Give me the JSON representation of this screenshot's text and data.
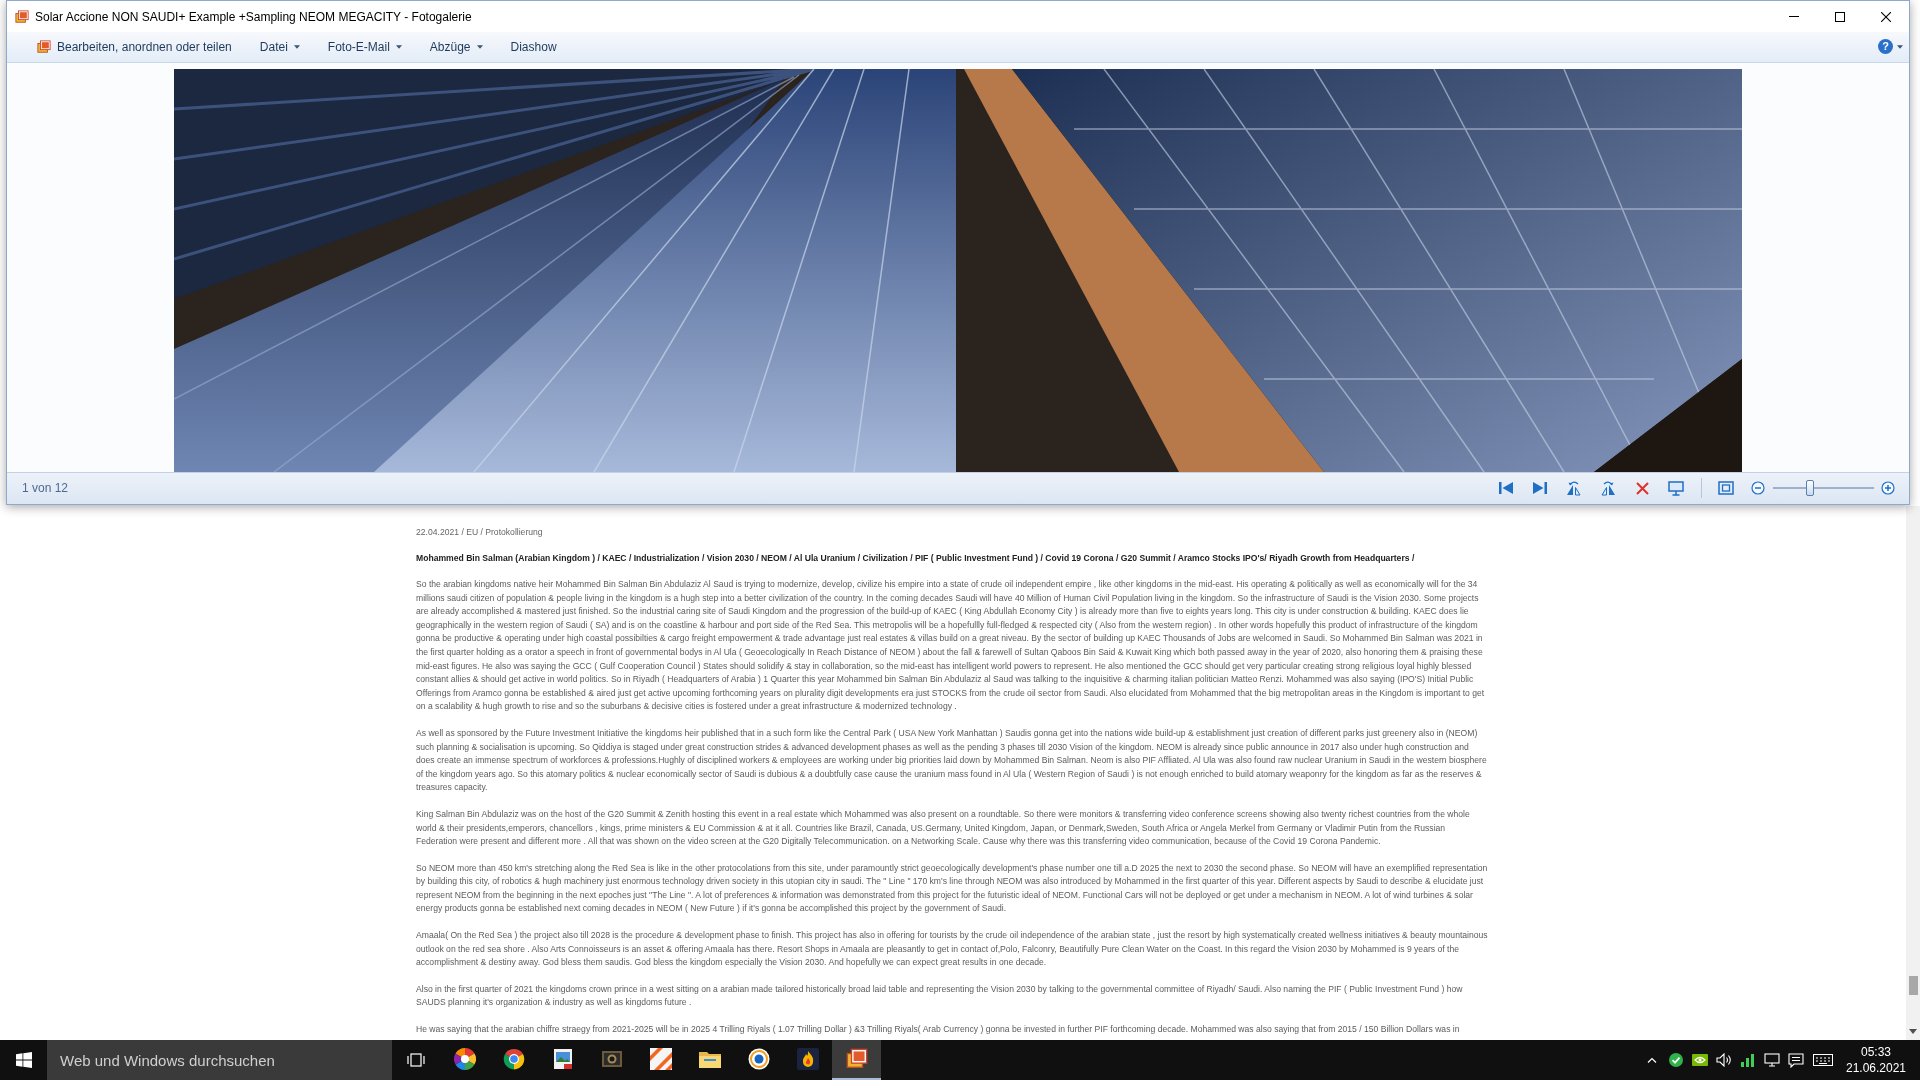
{
  "window": {
    "title": "Solar Accione NON SAUDI+ Example +Sampling NEOM MEGACITY - Fotogalerie"
  },
  "menu": {
    "items": [
      {
        "label": "Bearbeiten, anordnen oder teilen",
        "kind": "icon"
      },
      {
        "label": "Datei",
        "kind": "dropdown"
      },
      {
        "label": "Foto-E-Mail",
        "kind": "dropdown"
      },
      {
        "label": "Abzüge",
        "kind": "dropdown"
      },
      {
        "label": "Diashow",
        "kind": "plain"
      }
    ],
    "help": "?"
  },
  "viewer": {
    "position": "1 von 12",
    "zoom": {
      "level": 0.37
    }
  },
  "document": {
    "meta": "22.04.2021 / EU / Protokollierung",
    "headline": "Mohammed Bin Salman (Arabian Kingdom ) / KAEC / Industrialization / Vision 2030 / NEOM / Al Ula Uranium / Civilization / PIF ( Public Investment Fund ) / Covid 19 Corona / G20 Summit / Aramco Stocks IPO's/ Riyadh Growth from Headquarters /",
    "paragraphs": [
      "So the arabian kingdoms native heir Mohammed Bin Salman Bin Abdulaziz Al Saud is trying to modernize, develop, civilize his empire into a state of crude oil independent empire , like other kingdoms in the mid-east. His operating & politically as well as economically will for the 34 millions saudi citizen of population & people living in the kingdom is a hugh step into a better civilization of the country. In the coming decades Saudi will have 40 Million of Human Civil Population living in the kingdom. So the infrastructure of Saudi is the Vision 2030. Some projects are already accomplished & mastered just finished. So the industrial caring site of Saudi Kingdom and the progression of the build-up of KAEC ( King Abdullah Economy City ) is already more than five to eights years long. This city is under construction & building. KAEC does lie geographically in the western region of Saudi ( SA) and is on the coastline & harbour and port side of the Red Sea. This metropolis will be a hopefullly full-fledged & respected city ( Also from the western region) . In other words hopefully this product of infrastructure of the kingdom gonna be productive & operating under high coastal possibilties & cargo freight empowerment & trade advantage just real estates & villas build on a great niveau. By the sector of building up KAEC Thousands of Jobs are welcomed in Saudi. So Mohammed Bin Salman was 2021 in the first quarter holding as a orator a speech in front of governmental bodys in Al Ula ( Geoecologically In Reach Distance of NEOM ) about the fall & farewell of Sultan Qaboos Bin Said & Kuwait King which both passed away in the year of 2020, also honoring them & praising these mid-east figures. He also was saying the GCC ( Gulf Cooperation Council ) States should solidify & stay in collaboration, so the mid-east has intelligent world powers to represent. He also mentioned the GCC should get very particular creating strong religious loyal highly blessed constant allies & should get active in world politics. So in Riyadh ( Headquarters of Arabia ) 1 Quarter this year Mohammed bin Salman Bin Abdulaziz al Saud was talking to the inquisitive & charming italian politician Matteo Renzi. Mohammed was also saying (IPO'S) Initial Public Offerings from Aramco gonna be established & aired just get active upcoming forthcoming years on plurality digit developments era just STOCKS from the crude oil sector from Saudi. Also elucidated from Mohammed that the big metropolitan areas in the Kingdom is important to get on a scalability & hugh growth to rise and so the suburbans & decisive cities is fostered under a great infrastructure & modernized technology .",
      "As well as sponsored by the Future Investment Initiative the kingdoms heir published that in a such form like the Central Park ( USA New York Manhattan ) Saudis gonna get into the nations wide build-up & establishment just creation of different parks just greenery also in (NEOM) such planning & socialisation is upcoming. So Qiddiya is staged under great construction strides & advanced development phases as well as the pending 3 phases till 2030 Vision of the kingdom. NEOM is already since public announce in 2017 also under hugh construction and does create an immense spectrum of workforces & professions.Hughly of disciplined workers & employees are working under big priorities laid down by Mohammed Bin Salman. Neom is also PIF Affliated. Al Ula was also found raw nuclear Uranium in Saudi in the western biosphere of the kingdom years ago. So this atomary politics & nuclear economically sector of Saudi is dubious & a doubtfully case cause the uranium mass found in Al Ula ( Western Region of Saudi ) is not enough enriched to build atomary weaponry for the kingdom as far as the reserves & treasures capacity.",
      "King Salman Bin Abdulaziz was on the host of the G20 Summit & Zenith hosting this event in a real estate which Mohammed was also present on a roundtable. So there were monitors & transferring video conference screens showing also twenty richest countries from the whole world & their presidents,emperors, chancellors , kings, prime ministers & EU Commission & at it all. Countries like Brazil, Canada, US.Germany, United Kingdom, Japan, or Denmark,Sweden, South Africa or Angela Merkel from Germany or Vladimir Putin from the Russian Federation were present and different more . All that was shown on the video screen at the G20 Digitally Telecommunication. on a Networking Scale. Cause why there was this transferring video communication, because of the Covid 19 Corona Pandemic.",
      "So NEOM more than 450 km's stretching along the Red Sea is like in the other protocolations from this site, under paramountly strict geoecologically development's phase number one till a.D 2025 the next to 2030 the second phase. So NEOM will have an exemplified representation by building this city, of robotics & hugh machinery just enormous technology driven society in this utopian city in saudi. The \" Line \" 170 km's line through NEOM was also introduced by Mohammed in the first quarter of this year. Different aspects by Saudi to describe & elucidate just represent NEOM from the beginning in the next epoches just \"The Line \". A lot of preferences & information was demonstrated from this project for the futuristic ideal of NEOM. Functional Cars will not be deployed or get under a mechanism in NEOM. A lot of wind turbines & solar energy products gonna be established next coming decades in NEOM ( New Future ) if it's gonna be accomplished this project by the government of Saudi.",
      "Amaala( On the Red Sea ) the project also till 2028 is the procedure & development phase to finish. This project has also in offering for tourists by the crude oil independence of the arabian state , just the resort by high systematically created wellness initiatives & beauty mountainous outlook on the red sea shore . Also Arts Connoisseurs is an asset & offering Amaala has there. Resort Shops in Amaala are pleasantly to get in contact of,Polo, Falconry, Beautifully Pure Clean Water on the Coast. In this regard the Vision 2030 by Mohammed is 9 years of the accomplishment & destiny away. God bless them saudis. God bless the kingdom especially the Vision 2030. And hopefully we can expect great results in one decade.",
      "Also in the first quarter of 2021 the kingdoms crown prince in a west sitting on a arabian made tailored historically broad laid table and representing the Vision 2030 by talking to the governmental committee of Riyadh/ Saudi. Also naming the PIF ( Public Investment Fund ) how SAUDS planning it's organization & industry as well as kingdoms future .",
      "He was saying that the arabian chiffre straegy from 2021-2025 will be in 2025 4 Trilling Riyals ( 1.07 Trilling Dollar ) &3 Trilling Riyals( Arab Currency ) gonna be invested in further PIF forthcoming decade. Mohammed was also saying that from 2015 / 150 Billion Dollars was in"
    ]
  },
  "taskbar": {
    "search": {
      "placeholder": "Web und Windows durchsuchen"
    },
    "apps": [
      {
        "selected": false
      },
      {
        "selected": false
      },
      {
        "selected": false
      },
      {
        "selected": false
      },
      {
        "selected": false
      },
      {
        "selected": false
      },
      {
        "selected": false
      },
      {
        "selected": false
      },
      {
        "selected": true
      }
    ],
    "clock": {
      "time": "05:33",
      "date": "21.06.2021"
    }
  }
}
